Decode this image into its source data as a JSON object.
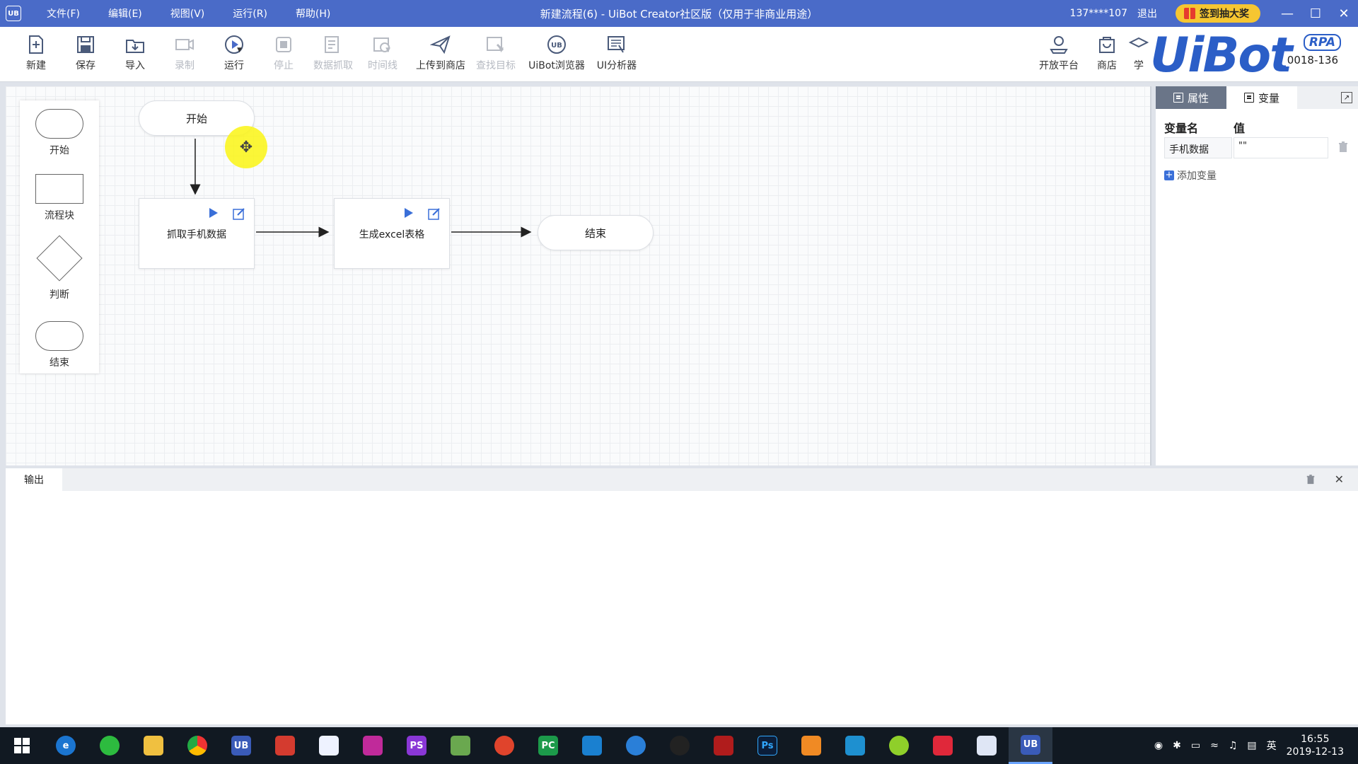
{
  "app": {
    "logo": "UB",
    "menu": [
      "文件(F)",
      "编辑(E)",
      "视图(V)",
      "运行(R)",
      "帮助(H)"
    ],
    "title": "新建流程(6) - UiBot Creator社区版（仅用于非商业用途）",
    "user": "137****107",
    "logout": "退出",
    "lottery": "签到抽大奖",
    "window_controls": [
      "minimize-icon",
      "maximize-icon",
      "close-icon"
    ]
  },
  "toolbar": {
    "new": "新建",
    "save": "保存",
    "import": "导入",
    "record": "录制",
    "run": "运行",
    "stop": "停止",
    "data_scrape": "数据抓取",
    "timeline": "时间线",
    "upload_store": "上传到商店",
    "find_target": "查找目标",
    "browser": "UiBot浏览器",
    "ui_analyzer": "UI分析器",
    "open_platform": "开放平台",
    "store": "商店",
    "learn_partial": "学"
  },
  "brand": {
    "word": "UiBot",
    "rpa": "RPA",
    "version_partial": "0018-136"
  },
  "palette": {
    "start": "开始",
    "block": "流程块",
    "decision": "判断",
    "end": "结束"
  },
  "flow": {
    "start": "开始",
    "block1": "抓取手机数据",
    "block2": "生成excel表格",
    "end": "结束"
  },
  "right_panel": {
    "tab_properties": "属性",
    "tab_variables": "变量",
    "header_name": "变量名",
    "header_value": "值",
    "variables": [
      {
        "name": "手机数据",
        "value": "\"\""
      }
    ],
    "add_variable": "添加变量"
  },
  "output": {
    "tab": "输出"
  },
  "taskbar": {
    "apps": [
      "windows-start-icon",
      "edge-icon",
      "wechat-icon",
      "file-explorer-icon",
      "chrome-icon",
      "uibot-icon",
      "app-icon",
      "app-icon",
      "app-icon",
      "phpstorm-icon",
      "app-icon",
      "app-icon",
      "pycharm-icon",
      "app-icon",
      "app-icon",
      "qq-icon",
      "acrobat-icon",
      "photoshop-icon",
      "app-icon",
      "app-icon",
      "app-icon",
      "app-icon",
      "app-icon",
      "uibot-creator-icon"
    ],
    "ime": "英",
    "time": "16:55",
    "date": "2019-12-13"
  },
  "colors": {
    "titlebar": "#4a6bc8",
    "brand": "#2b5ec7",
    "lottery": "#f6c631",
    "highlight": "#faf514"
  }
}
